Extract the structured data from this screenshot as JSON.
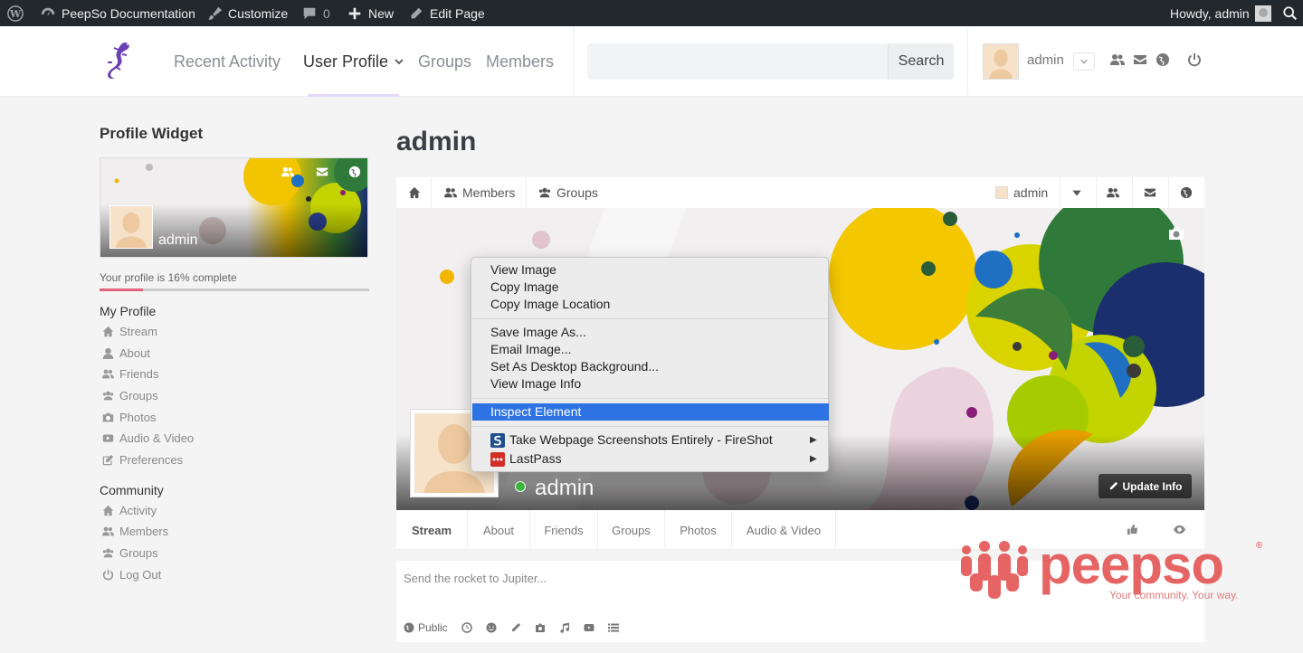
{
  "adminbar": {
    "site_name": "PeepSo Documentation",
    "customize": "Customize",
    "comments_count": "0",
    "new_label": "New",
    "edit_page": "Edit Page",
    "howdy": "Howdy, admin"
  },
  "header": {
    "nav": {
      "recent_activity": "Recent Activity",
      "user_profile": "User Profile",
      "groups": "Groups",
      "members": "Members"
    },
    "search_button": "Search",
    "search_placeholder": "",
    "user_name": "admin"
  },
  "sidebar": {
    "widget_title": "Profile Widget",
    "widget_name": "admin",
    "progress_label": "Your profile is 16% complete",
    "progress_value": 0.16,
    "my_profile_title": "My Profile",
    "my_profile_items": [
      "Stream",
      "About",
      "Friends",
      "Groups",
      "Photos",
      "Audio & Video",
      "Preferences"
    ],
    "community_title": "Community",
    "community_items": [
      "Activity",
      "Members",
      "Groups",
      "Log Out"
    ]
  },
  "main": {
    "page_title": "admin",
    "profile_nav": {
      "members": "Members",
      "groups": "Groups",
      "user": "admin"
    },
    "cover_name": "admin",
    "update_info": "Update Info",
    "tabs": [
      "Stream",
      "About",
      "Friends",
      "Groups",
      "Photos",
      "Audio & Video"
    ],
    "post_placeholder": "Send the rocket to Jupiter...",
    "privacy_label": "Public"
  },
  "context_menu": {
    "items": [
      "View Image",
      "Copy Image",
      "Copy Image Location",
      "Save Image As...",
      "Email Image...",
      "Set As Desktop Background...",
      "View Image Info",
      "Inspect Element",
      "Take Webpage Screenshots Entirely - FireShot",
      "LastPass"
    ]
  },
  "watermark": {
    "brand": "peepso",
    "tagline": "Your community. Your way.",
    "registered": "®"
  },
  "colors": {
    "adminbar_bg": "#23282d",
    "accent_pink": "#e2627e",
    "menu_highlight": "#2d73e3",
    "online": "#3cbc3c",
    "brand_red": "#e24a4a"
  }
}
